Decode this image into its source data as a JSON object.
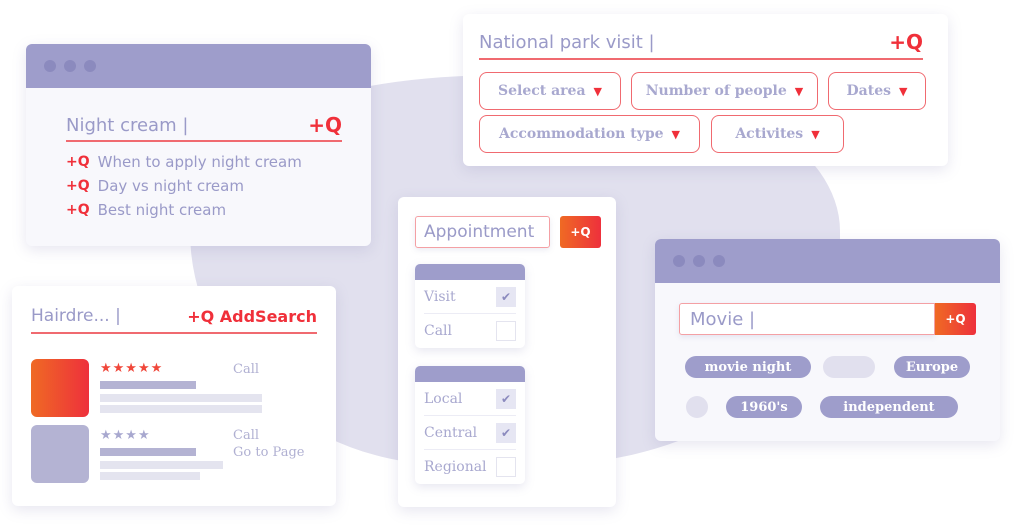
{
  "brand": {
    "accent": "#f0303a",
    "lavender": "#9e9dcb",
    "muted_text": "#9a9ac8"
  },
  "search_icon_glyph": "+Q",
  "night_cream": {
    "query": "Night cream |",
    "suggestions": [
      "When to apply night cream",
      "Day vs night cream",
      "Best night cream"
    ]
  },
  "national_park": {
    "query": "National park visit |",
    "filters": [
      {
        "label": "Select area"
      },
      {
        "label": "Number of people"
      },
      {
        "label": "Dates"
      },
      {
        "label": "Accommodation type"
      },
      {
        "label": "Activites"
      }
    ],
    "arrow_glyph": "▼"
  },
  "hairdresser": {
    "query": "Hairdre... |",
    "brand_label": "+Q AddSearch",
    "results": [
      {
        "rating": 5,
        "rating_max": 5,
        "stars": "★★★★★",
        "actions": [
          "Call"
        ]
      },
      {
        "rating": 4,
        "rating_max": 5,
        "stars": "★★★★",
        "actions": [
          "Call",
          "Go to Page"
        ]
      }
    ]
  },
  "appointment": {
    "query": "Appointment",
    "button_label": "+Q",
    "group1": [
      {
        "label": "Visit",
        "checked": true
      },
      {
        "label": "Call",
        "checked": false
      }
    ],
    "group2": [
      {
        "label": "Local",
        "checked": true
      },
      {
        "label": "Central",
        "checked": true
      },
      {
        "label": "Regional",
        "checked": false
      }
    ],
    "check_glyph": "✔"
  },
  "movie": {
    "query": "Movie |",
    "button_label": "+Q",
    "tags": [
      "movie night",
      "Europe",
      "1960's",
      "independent"
    ]
  }
}
